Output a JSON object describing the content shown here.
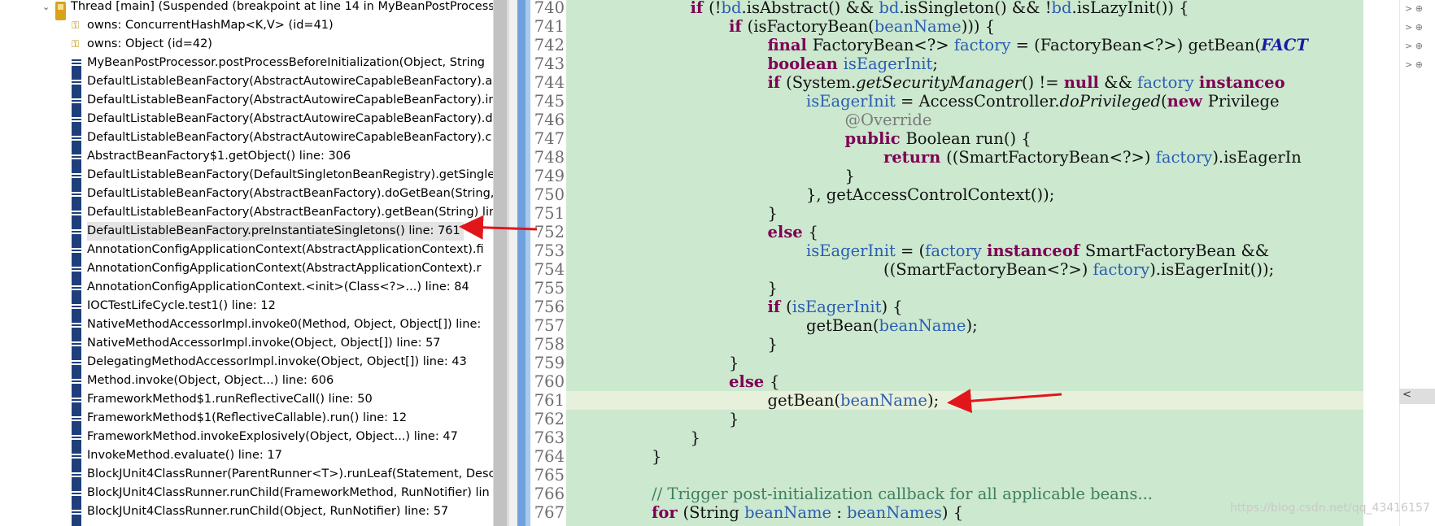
{
  "stack": {
    "rows": [
      {
        "kind": "thread",
        "text": "Thread [main] (Suspended (breakpoint at line 14 in MyBeanPostProcess"
      },
      {
        "kind": "lock",
        "text": "owns: ConcurrentHashMap<K,V>  (id=41)"
      },
      {
        "kind": "lock",
        "text": "owns: Object  (id=42)"
      },
      {
        "kind": "frame",
        "text": "MyBeanPostProcessor.postProcessBeforeInitialization(Object, String"
      },
      {
        "kind": "frame",
        "text": "DefaultListableBeanFactory(AbstractAutowireCapableBeanFactory).a"
      },
      {
        "kind": "frame",
        "text": "DefaultListableBeanFactory(AbstractAutowireCapableBeanFactory).in"
      },
      {
        "kind": "frame",
        "text": "DefaultListableBeanFactory(AbstractAutowireCapableBeanFactory).d"
      },
      {
        "kind": "frame",
        "text": "DefaultListableBeanFactory(AbstractAutowireCapableBeanFactory).c"
      },
      {
        "kind": "frame",
        "text": "AbstractBeanFactory$1.getObject() line: 306"
      },
      {
        "kind": "frame",
        "text": "DefaultListableBeanFactory(DefaultSingletonBeanRegistry).getSingle"
      },
      {
        "kind": "frame",
        "text": "DefaultListableBeanFactory(AbstractBeanFactory).doGetBean(String,"
      },
      {
        "kind": "frame",
        "text": "DefaultListableBeanFactory(AbstractBeanFactory).getBean(String) lin"
      },
      {
        "kind": "frame",
        "text": "DefaultListableBeanFactory.preInstantiateSingletons() line: 761",
        "selected": true
      },
      {
        "kind": "frame",
        "text": "AnnotationConfigApplicationContext(AbstractApplicationContext).fi"
      },
      {
        "kind": "frame",
        "text": "AnnotationConfigApplicationContext(AbstractApplicationContext).r"
      },
      {
        "kind": "frame",
        "text": "AnnotationConfigApplicationContext.<init>(Class<?>...) line: 84"
      },
      {
        "kind": "frame",
        "text": "IOCTestLifeCycle.test1() line: 12"
      },
      {
        "kind": "frame",
        "text": "NativeMethodAccessorImpl.invoke0(Method, Object, Object[]) line:"
      },
      {
        "kind": "frame",
        "text": "NativeMethodAccessorImpl.invoke(Object, Object[]) line: 57"
      },
      {
        "kind": "frame",
        "text": "DelegatingMethodAccessorImpl.invoke(Object, Object[]) line: 43"
      },
      {
        "kind": "frame",
        "text": "Method.invoke(Object, Object...) line: 606"
      },
      {
        "kind": "frame",
        "text": "FrameworkMethod$1.runReflectiveCall() line: 50"
      },
      {
        "kind": "frame",
        "text": "FrameworkMethod$1(ReflectiveCallable).run() line: 12"
      },
      {
        "kind": "frame",
        "text": "FrameworkMethod.invokeExplosively(Object, Object...) line: 47"
      },
      {
        "kind": "frame",
        "text": "InvokeMethod.evaluate() line: 17"
      },
      {
        "kind": "frame",
        "text": "BlockJUnit4ClassRunner(ParentRunner<T>).runLeaf(Statement, Descr"
      },
      {
        "kind": "frame",
        "text": "BlockJUnit4ClassRunner.runChild(FrameworkMethod, RunNotifier) lin"
      },
      {
        "kind": "frame",
        "text": "BlockJUnit4ClassRunner.runChild(Object, RunNotifier) line: 57"
      }
    ]
  },
  "editor": {
    "current_line": "761",
    "lines": [
      {
        "n": "740",
        "ind": 3,
        "toks": [
          [
            "kw",
            "if "
          ],
          [
            "",
            "(!"
          ],
          [
            "fld",
            "bd"
          ],
          [
            "",
            ".isAbstract() && "
          ],
          [
            "fld",
            "bd"
          ],
          [
            "",
            ".isSingleton() && !"
          ],
          [
            "fld",
            "bd"
          ],
          [
            "",
            ".isLazyInit()) {"
          ]
        ]
      },
      {
        "n": "741",
        "ind": 4,
        "toks": [
          [
            "kw",
            "if "
          ],
          [
            "",
            "(isFactoryBean("
          ],
          [
            "fld",
            "beanName"
          ],
          [
            "",
            "))) {"
          ]
        ]
      },
      {
        "n": "742",
        "ind": 5,
        "toks": [
          [
            "kw",
            "final "
          ],
          [
            "",
            "FactoryBean<?> "
          ],
          [
            "fld",
            "factory"
          ],
          [
            "",
            " = (FactoryBean<?>) getBean("
          ],
          [
            "cst",
            "FACT"
          ]
        ]
      },
      {
        "n": "743",
        "ind": 5,
        "toks": [
          [
            "kw",
            "boolean "
          ],
          [
            "fld",
            "isEagerInit"
          ],
          [
            "",
            ";"
          ]
        ]
      },
      {
        "n": "744",
        "ind": 5,
        "toks": [
          [
            "kw",
            "if "
          ],
          [
            "",
            "(System."
          ],
          [
            "it",
            "getSecurityManager"
          ],
          [
            "",
            "() != "
          ],
          [
            "kw",
            "null"
          ],
          [
            "",
            " && "
          ],
          [
            "fld",
            "factory "
          ],
          [
            "kw",
            "instanceo"
          ]
        ]
      },
      {
        "n": "745",
        "ind": 6,
        "toks": [
          [
            "fld",
            "isEagerInit"
          ],
          [
            "",
            " = AccessController."
          ],
          [
            "it",
            "doPrivileged"
          ],
          [
            "",
            "("
          ],
          [
            "kw",
            "new "
          ],
          [
            "",
            "Privilege"
          ]
        ]
      },
      {
        "n": "746",
        "ind": 7,
        "toks": [
          [
            "an",
            "@Override"
          ]
        ]
      },
      {
        "n": "747",
        "ind": 7,
        "toks": [
          [
            "kw",
            "public "
          ],
          [
            "",
            "Boolean run() {"
          ]
        ]
      },
      {
        "n": "748",
        "ind": 8,
        "toks": [
          [
            "kw",
            "return "
          ],
          [
            "",
            "((SmartFactoryBean<?>) "
          ],
          [
            "fld",
            "factory"
          ],
          [
            "",
            ").isEagerIn"
          ]
        ]
      },
      {
        "n": "749",
        "ind": 7,
        "toks": [
          [
            "",
            "}"
          ]
        ]
      },
      {
        "n": "750",
        "ind": 6,
        "toks": [
          [
            "",
            "}, getAccessControlContext());"
          ]
        ]
      },
      {
        "n": "751",
        "ind": 5,
        "toks": [
          [
            "",
            "}"
          ]
        ]
      },
      {
        "n": "752",
        "ind": 5,
        "toks": [
          [
            "kw",
            "else "
          ],
          [
            "",
            "{"
          ]
        ]
      },
      {
        "n": "753",
        "ind": 6,
        "toks": [
          [
            "fld",
            "isEagerInit"
          ],
          [
            "",
            " = ("
          ],
          [
            "fld",
            "factory "
          ],
          [
            "kw",
            "instanceof "
          ],
          [
            "",
            "SmartFactoryBean &&"
          ]
        ]
      },
      {
        "n": "754",
        "ind": 8,
        "toks": [
          [
            "",
            "((SmartFactoryBean<?>) "
          ],
          [
            "fld",
            "factory"
          ],
          [
            "",
            ").isEagerInit());"
          ]
        ]
      },
      {
        "n": "755",
        "ind": 5,
        "toks": [
          [
            "",
            "}"
          ]
        ]
      },
      {
        "n": "756",
        "ind": 5,
        "toks": [
          [
            "kw",
            "if "
          ],
          [
            "",
            "("
          ],
          [
            "fld",
            "isEagerInit"
          ],
          [
            "",
            ") {"
          ]
        ]
      },
      {
        "n": "757",
        "ind": 6,
        "toks": [
          [
            "",
            "getBean("
          ],
          [
            "fld",
            "beanName"
          ],
          [
            "",
            ");"
          ]
        ]
      },
      {
        "n": "758",
        "ind": 5,
        "toks": [
          [
            "",
            "}"
          ]
        ]
      },
      {
        "n": "759",
        "ind": 4,
        "toks": [
          [
            "",
            "}"
          ]
        ]
      },
      {
        "n": "760",
        "ind": 4,
        "toks": [
          [
            "kw",
            "else "
          ],
          [
            "",
            "{"
          ]
        ]
      },
      {
        "n": "761",
        "ind": 5,
        "toks": [
          [
            "",
            "getBean("
          ],
          [
            "fld",
            "beanName"
          ],
          [
            "",
            ");"
          ]
        ]
      },
      {
        "n": "762",
        "ind": 4,
        "toks": [
          [
            "",
            "}"
          ]
        ]
      },
      {
        "n": "763",
        "ind": 3,
        "toks": [
          [
            "",
            "}"
          ]
        ]
      },
      {
        "n": "764",
        "ind": 2,
        "toks": [
          [
            "",
            "}"
          ]
        ]
      },
      {
        "n": "765",
        "ind": 0,
        "toks": []
      },
      {
        "n": "766",
        "ind": 2,
        "toks": [
          [
            "cm",
            "// Trigger post-initialization callback for all applicable beans..."
          ]
        ]
      },
      {
        "n": "767",
        "ind": 2,
        "toks": [
          [
            "kw",
            "for "
          ],
          [
            "",
            "(String "
          ],
          [
            "fld",
            "beanName"
          ],
          [
            "",
            " : "
          ],
          [
            "fld",
            "beanNames"
          ],
          [
            "",
            ") {"
          ]
        ]
      }
    ]
  },
  "outline": {
    "items": [
      "> ⊕",
      "> ⊕",
      "> ⊕",
      "> ⊕"
    ]
  },
  "watermark": "https://blog.csdn.net/qq_43416157",
  "colors": {
    "arrow": "#e0161b",
    "code_bg": "#cce8cf",
    "keyword": "#7f0055"
  }
}
